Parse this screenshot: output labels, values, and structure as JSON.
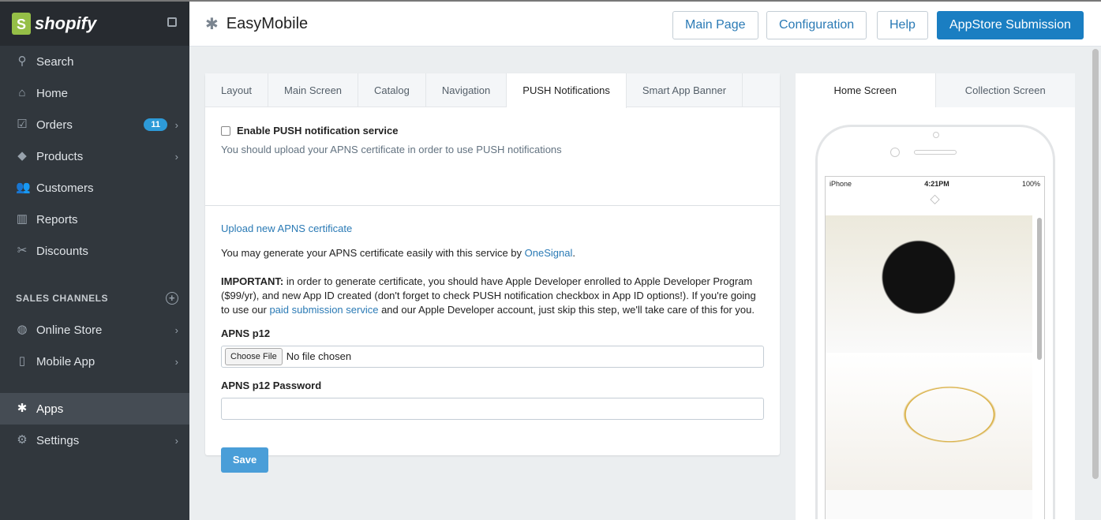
{
  "sidebar": {
    "brand": "shopify",
    "items": [
      {
        "label": "Search",
        "icon": "search-icon"
      },
      {
        "label": "Home",
        "icon": "home-icon"
      },
      {
        "label": "Orders",
        "icon": "orders-icon",
        "badge": "11"
      },
      {
        "label": "Products",
        "icon": "tag-icon"
      },
      {
        "label": "Customers",
        "icon": "customers-icon"
      },
      {
        "label": "Reports",
        "icon": "reports-icon"
      },
      {
        "label": "Discounts",
        "icon": "discounts-icon"
      }
    ],
    "section": "SALES CHANNELS",
    "channels": [
      {
        "label": "Online Store"
      },
      {
        "label": "Mobile App"
      }
    ],
    "bottom": [
      {
        "label": "Apps"
      },
      {
        "label": "Settings"
      }
    ]
  },
  "header": {
    "title": "EasyMobile",
    "buttons": [
      "Main Page",
      "Configuration",
      "Help",
      "AppStore Submission"
    ]
  },
  "panel": {
    "tabs": [
      "Layout",
      "Main Screen",
      "Catalog",
      "Navigation",
      "PUSH Notifications",
      "Smart App Banner"
    ],
    "enable_label": "Enable PUSH notification service",
    "enable_hint": "You should upload your APNS certificate in order to use PUSH notifications",
    "upload_link": "Upload new APNS certificate",
    "generate_text": "You may generate your APNS certificate easily with this service by ",
    "generate_link": "OneSignal",
    "important_label": "IMPORTANT:",
    "important_text1": " in order to generate certificate, you should have Apple Developer enrolled to Apple Developer Program ($99/yr), and new App ID created (don't forget to check PUSH notification checkbox in App ID options!). If you're going to use our ",
    "important_link": "paid submission service",
    "important_text2": " and our Apple Developer account, just skip this step, we'll take care of this for you.",
    "p12_label": "APNS p12",
    "choose_file": "Choose File",
    "no_file": "No file chosen",
    "password_label": "APNS p12 Password",
    "password_value": "",
    "save": "Save"
  },
  "preview": {
    "tabs": [
      "Home Screen",
      "Collection Screen"
    ],
    "carrier": "iPhone",
    "time": "4:21PM",
    "battery": "100%"
  }
}
